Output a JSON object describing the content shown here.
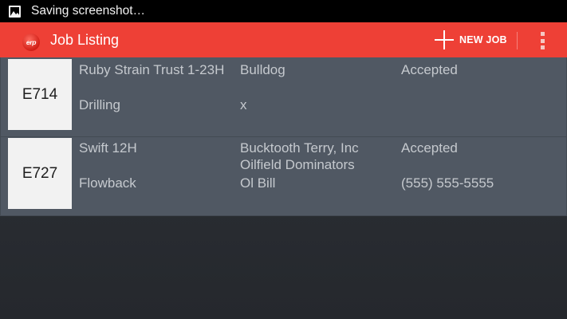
{
  "status_bar": {
    "icon": "gallery-icon",
    "text": "Saving screenshot…"
  },
  "action_bar": {
    "logo_text": "erp",
    "title": "Job Listing",
    "new_job_label": "NEW JOB",
    "overflow_icon": "overflow-menu-icon",
    "color": "#ee4036"
  },
  "jobs": [
    {
      "code": "E714",
      "well": "Ruby Strain Trust 1-23H",
      "type": "Drilling",
      "company": "Bulldog",
      "contact": "x",
      "status": "Accepted",
      "phone": ""
    },
    {
      "code": "E727",
      "well": "Swift 12H",
      "type": "Flowback",
      "company_line1": "Bucktooth Terry, Inc",
      "company_line2": "Oilfield Dominators",
      "contact": "Ol Bill",
      "status": "Accepted",
      "phone": "(555) 555-5555"
    }
  ]
}
